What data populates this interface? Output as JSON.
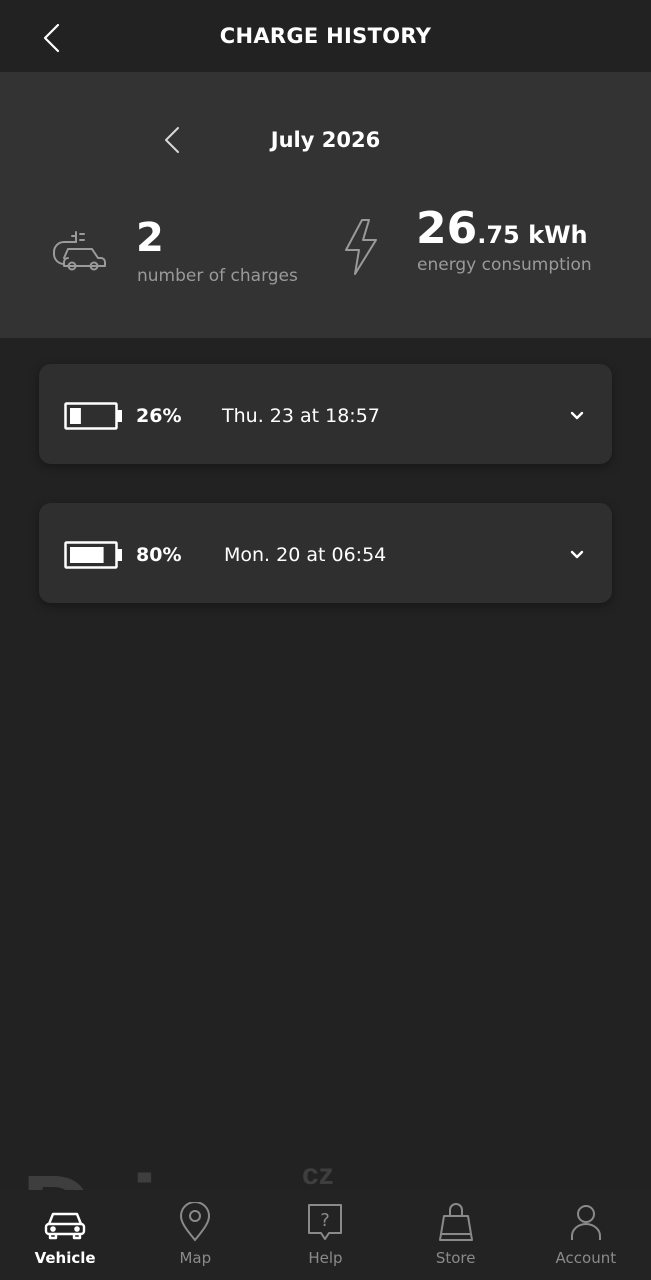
{
  "header": {
    "title": "CHARGE HISTORY",
    "back_icon": "chevron-left-icon"
  },
  "summary": {
    "month": "July 2026",
    "charges": {
      "icon": "car-plug-icon",
      "value": "2",
      "label": "number of charges"
    },
    "energy": {
      "icon": "lightning-bolt-icon",
      "value_main": "26",
      "value_decimal": ".75 kWh",
      "label": "energy consumption"
    }
  },
  "charges": [
    {
      "battery_level": 0.26,
      "percent": "26%",
      "date": "Thu. 23 at 18:57",
      "icon": "chevron-down-icon"
    },
    {
      "battery_level": 0.8,
      "percent": "80%",
      "date": "Mon. 20 at 06:54",
      "icon": "chevron-down-icon"
    }
  ],
  "watermark": {
    "text": "Drive",
    "suffix": "cz"
  },
  "bottom_nav": [
    {
      "label": "Vehicle",
      "icon": "car-icon",
      "active": true
    },
    {
      "label": "Map",
      "icon": "map-pin-icon",
      "active": false
    },
    {
      "label": "Help",
      "icon": "help-icon",
      "active": false
    },
    {
      "label": "Store",
      "icon": "shopping-bag-icon",
      "active": false
    },
    {
      "label": "Account",
      "icon": "person-icon",
      "active": false
    }
  ],
  "colors": {
    "background": "#222222",
    "summary_panel": "#333333",
    "card": "#2f2f2f",
    "text": "#ffffff",
    "muted_text": "#9a9a9a",
    "icon_muted": "#8a8a8a"
  }
}
